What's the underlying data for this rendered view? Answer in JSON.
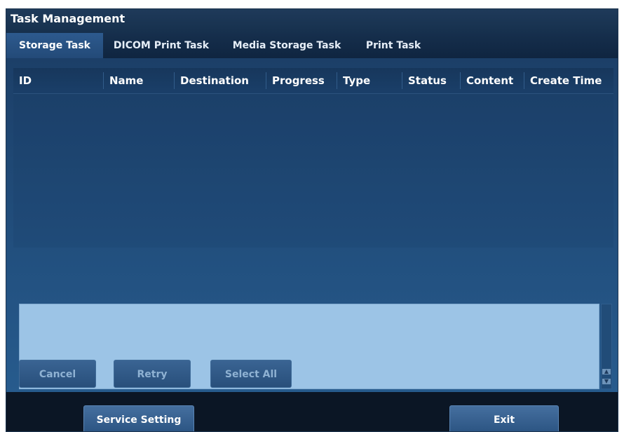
{
  "window": {
    "title": "Task Management"
  },
  "tabs": [
    {
      "label": "Storage Task",
      "active": true
    },
    {
      "label": "DICOM Print Task",
      "active": false
    },
    {
      "label": "Media Storage Task",
      "active": false
    },
    {
      "label": "Print Task",
      "active": false
    }
  ],
  "table": {
    "columns": [
      "ID",
      "Name",
      "Destination",
      "Progress",
      "Type",
      "Status",
      "Content",
      "Create Time"
    ],
    "rows": []
  },
  "actions": {
    "cancel_label": "Cancel",
    "retry_label": "Retry",
    "select_all_label": "Select All"
  },
  "footer": {
    "service_setting_label": "Service Setting",
    "exit_label": "Exit"
  },
  "colors": {
    "titlebar": "#1f3a5a",
    "tab_active": "#2d5a8e",
    "panel": "#22507f",
    "detail_box": "#9cc4e6"
  }
}
